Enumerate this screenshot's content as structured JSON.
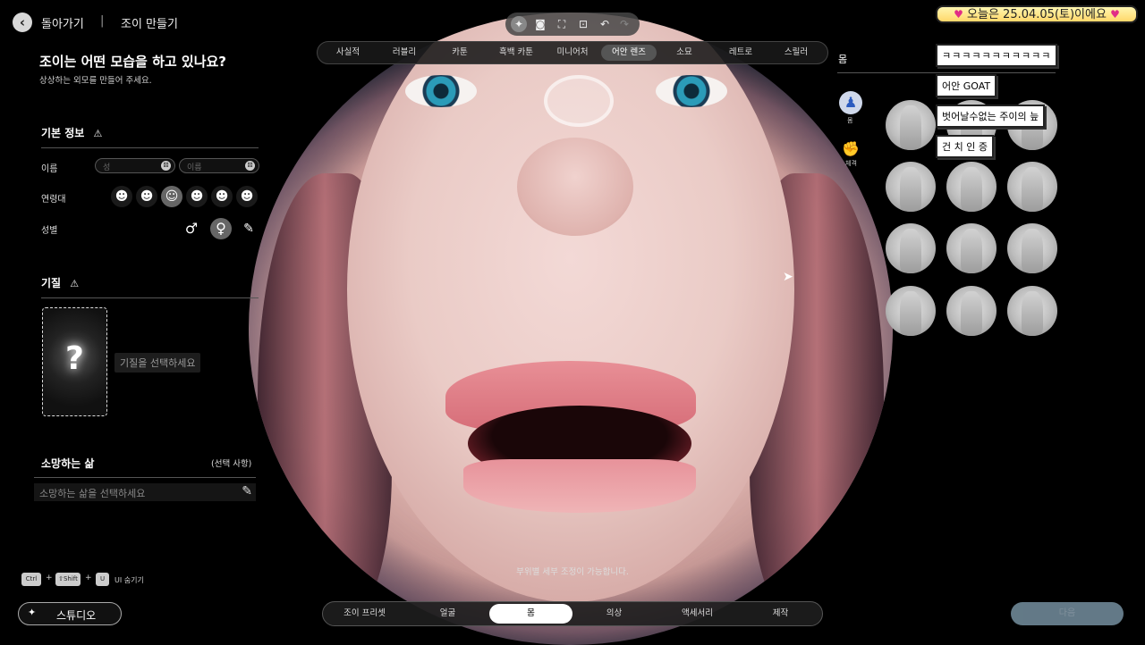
{
  "header": {
    "back_label": "돌아가기",
    "separator": "|",
    "create_label": "조이 만들기"
  },
  "intro": {
    "title": "조이는 어떤 모습을 하고 있나요?",
    "subtitle": "상상하는 외모를 만들어 주세요."
  },
  "basic_info": {
    "title": "기본 정보",
    "name_label": "이름",
    "last_name_placeholder": "성",
    "first_name_placeholder": "이름",
    "age_label": "연령대",
    "gender_label": "성별"
  },
  "trait": {
    "title": "기질",
    "hint": "기질을 선택하세요",
    "placeholder_symbol": "?"
  },
  "wish": {
    "title": "소망하는 삶",
    "optional": "(선택 사항)",
    "placeholder": "소망하는 삶을 선택하세요"
  },
  "shortcut": {
    "ctrl": "Ctrl",
    "shift": "⇧Shift",
    "u": "U",
    "plus": "+",
    "label": "UI 숨기기"
  },
  "studio_button": "스튜디오",
  "style_tabs": [
    "사실적",
    "러블리",
    "카툰",
    "흑백 카툰",
    "미니어처",
    "어안 렌즈",
    "소묘",
    "레트로",
    "스릴러"
  ],
  "style_selected": "어안 렌즈",
  "right_panel": {
    "title": "몸",
    "categories": [
      {
        "label": "몸",
        "icon": "body-icon"
      },
      {
        "label": "체격",
        "icon": "muscle-icon"
      }
    ]
  },
  "overlay": {
    "date": "오늘은 25.04.05(토)이에요",
    "comments": [
      "ㅋㅋㅋㅋㅋㅋㅋㅋㅋㅋㅋ",
      "어안 GOAT",
      "벗어날수없는 주이의 늪",
      "건 치 인 증"
    ]
  },
  "bottom_tabs": [
    "조이 프리셋",
    "얼굴",
    "몸",
    "의상",
    "액세서리",
    "제작"
  ],
  "bottom_selected": "몸",
  "detail_hint": "부위별 세부 조정이 가능합니다.",
  "next_button": "다음",
  "colors": {
    "background": "#000000",
    "selected_tab": "#ffffff",
    "date_highlight": "#ffd76a",
    "next_button": "#6e8796"
  }
}
